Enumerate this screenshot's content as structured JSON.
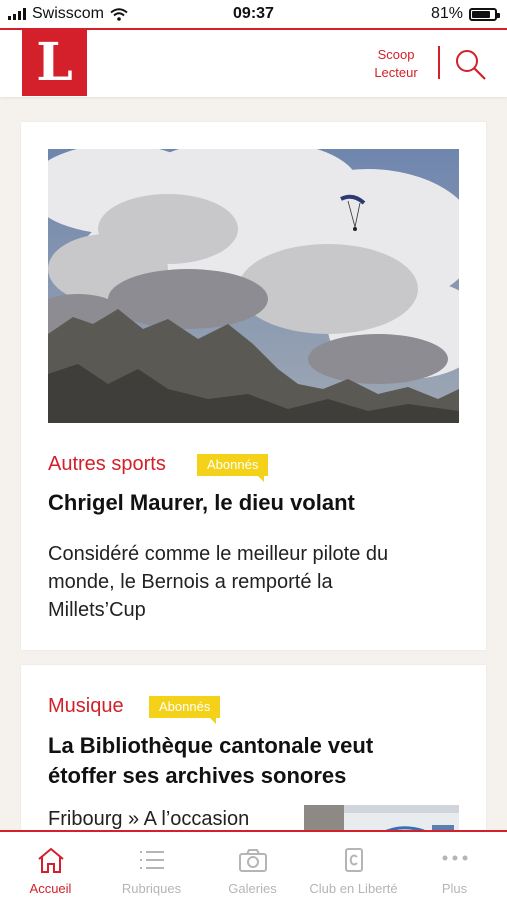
{
  "status_bar": {
    "carrier": "Swisscom",
    "time": "09:37",
    "battery": "81%",
    "battery_level": 0.81
  },
  "header": {
    "logo": "L",
    "scoop_line1": "Scoop",
    "scoop_line2": "Lecteur",
    "search_icon": "search-icon"
  },
  "articles": [
    {
      "category": "Autres sports",
      "badge": "Abonnés",
      "title": "Chrigel Maurer, le dieu volant",
      "lead_line1": "Considéré comme le meilleur pilote du",
      "lead_line2": "monde, le Bernois a remporté la",
      "lead_line3": "Millets’Cup"
    },
    {
      "category": "Musique",
      "badge": "Abonnés",
      "title_line1": "La Bibliothèque cantonale veut",
      "title_line2": "étoffer ses archives sonores",
      "lead": "Fribourg » A l’occasion"
    }
  ],
  "tabs": [
    {
      "label": "Accueil",
      "icon": "home-icon",
      "active": true
    },
    {
      "label": "Rubriques",
      "icon": "list-icon",
      "active": false
    },
    {
      "label": "Galeries",
      "icon": "camera-icon",
      "active": false
    },
    {
      "label": "Club en Liberté",
      "icon": "club-card-icon",
      "active": false
    },
    {
      "label": "Plus",
      "icon": "more-icon",
      "active": false
    }
  ],
  "colors": {
    "brand_red": "#d3202a",
    "badge_yellow": "#f4d21a",
    "page_bg": "#f5f1ec",
    "inactive_tab": "#b5b5b5"
  }
}
